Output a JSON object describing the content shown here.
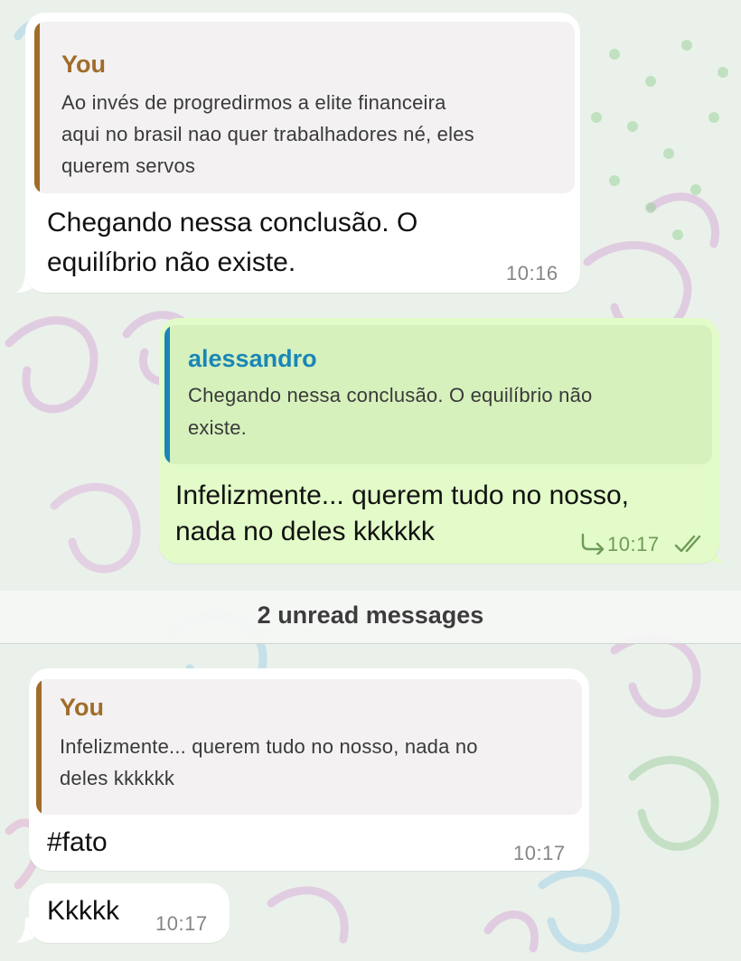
{
  "messages": [
    {
      "reply_name": "You",
      "reply_text": [
        "Ao invés de progredirmos a elite financeira",
        "aqui no brasil nao quer trabalhadores né, eles",
        "querem servos"
      ],
      "text": [
        "Chegando nessa conclusão. O",
        "equilíbrio não existe."
      ],
      "time": "10:16"
    },
    {
      "reply_name": "alessandro",
      "reply_text": [
        "Chegando nessa conclusão. O equilíbrio não",
        "existe."
      ],
      "text": [
        "Infelizmente... querem tudo no nosso,",
        "nada no deles kkkkkk"
      ],
      "time": "10:17"
    },
    {
      "reply_name": "You",
      "reply_text": [
        "Infelizmente... querem tudo no nosso, nada no",
        "deles kkkkkk"
      ],
      "text": [
        "#fato"
      ],
      "time": "10:17"
    },
    {
      "text": [
        "Kkkkk"
      ],
      "time": "10:17"
    }
  ],
  "unread_divider": "2 unread messages",
  "colors": {
    "incoming_bubble": "#ffffff",
    "outgoing_bubble": "#e2fbc8",
    "you_reply_accent": "#a06c2a",
    "alessandro_reply_accent": "#1a86b8"
  },
  "icons": {
    "forward": "forward-icon",
    "read_receipt": "double-check-icon"
  }
}
